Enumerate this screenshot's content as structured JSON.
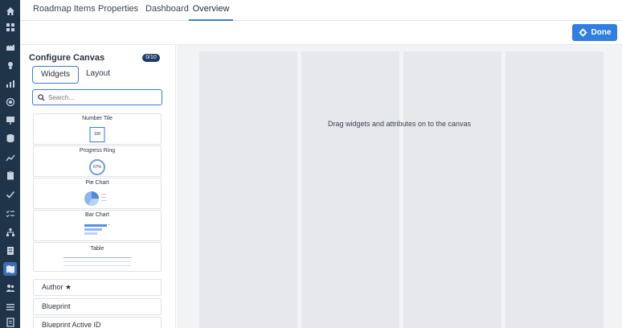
{
  "tabs": [
    {
      "label": "Roadmap Items"
    },
    {
      "label": "Properties"
    },
    {
      "label": "Dashboard"
    },
    {
      "label": "Overview",
      "active": true
    }
  ],
  "toolbar": {
    "done_label": "Done"
  },
  "panel": {
    "title": "Configure Canvas",
    "count": "0/10",
    "tabs": [
      {
        "label": "Widgets",
        "active": true
      },
      {
        "label": "Layout"
      }
    ],
    "search_placeholder": "Search...",
    "widgets": [
      {
        "label": "Number Tile",
        "preview_text": "100"
      },
      {
        "label": "Progress Ring",
        "preview_text": "67%"
      },
      {
        "label": "Pie Chart"
      },
      {
        "label": "Bar Chart"
      },
      {
        "label": "Table"
      }
    ],
    "attributes": [
      {
        "label": "Author ★"
      },
      {
        "label": "Blueprint"
      },
      {
        "label": "Blueprint Active ID"
      }
    ]
  },
  "canvas": {
    "hint": "Drag widgets and attributes on to the canvas"
  },
  "colors": {
    "rail": "#1f3349",
    "accent": "#2f7ee0",
    "canvas": "#f2f3f5",
    "column": "#e6e8eb"
  },
  "rail_icons": [
    "home-icon",
    "grid-icon",
    "factory-icon",
    "lightbulb-icon",
    "bar-chart-icon",
    "target-icon",
    "presentation-icon",
    "database-icon",
    "line-chart-icon",
    "clipboard-icon",
    "check-icon",
    "checklist-icon",
    "hierarchy-icon",
    "building-icon",
    "map-icon",
    "people-icon",
    "list-icon",
    "report-icon"
  ]
}
